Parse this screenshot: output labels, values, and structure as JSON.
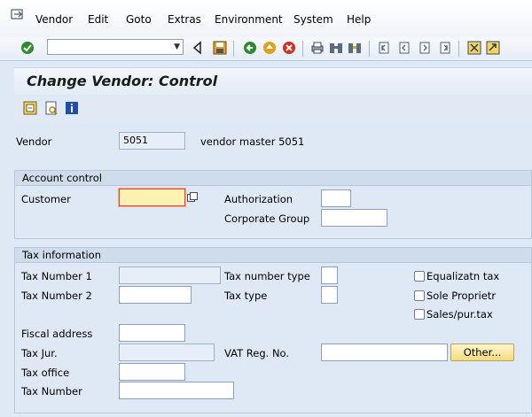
{
  "menu": {
    "items": [
      "Vendor",
      "Edit",
      "Goto",
      "Extras",
      "Environment",
      "System",
      "Help"
    ]
  },
  "toolbar": {
    "command_field_value": "",
    "icons": [
      "enter-icon",
      "back-arrow-icon",
      "save-icon",
      "back-icon",
      "exit-icon",
      "cancel-icon",
      "print-icon",
      "find-icon",
      "find-next-icon",
      "first-page-icon",
      "previous-page-icon",
      "next-page-icon",
      "last-page-icon",
      "create-session-icon",
      "shortcut-icon"
    ]
  },
  "title": "Change Vendor: Control",
  "app_toolbar": {
    "icons": [
      "other-vendor-icon",
      "display-icon",
      "info-icon"
    ]
  },
  "header": {
    "vendor_label": "Vendor",
    "vendor_value": "5051",
    "vendor_name": "vendor master 5051"
  },
  "account_control": {
    "title": "Account control",
    "customer_label": "Customer",
    "customer_value": "",
    "authorization_label": "Authorization",
    "authorization_value": "",
    "corporate_group_label": "Corporate Group",
    "corporate_group_value": ""
  },
  "tax_information": {
    "title": "Tax information",
    "tax_number_1_label": "Tax Number 1",
    "tax_number_1_value": "",
    "tax_number_2_label": "Tax Number 2",
    "tax_number_2_value": "",
    "tax_number_type_label": "Tax number type",
    "tax_number_type_value": "",
    "tax_type_label": "Tax type",
    "tax_type_value": "",
    "equalization_tax_label": "Equalizatn tax",
    "sole_proprietor_label": "Sole Proprietr",
    "sales_pur_tax_label": "Sales/pur.tax",
    "fiscal_address_label": "Fiscal address",
    "fiscal_address_value": "",
    "tax_jur_label": "Tax Jur.",
    "tax_jur_value": "",
    "vat_reg_label": "VAT Reg. No.",
    "vat_reg_value": "",
    "other_button": "Other...",
    "tax_office_label": "Tax office",
    "tax_office_value": "",
    "tax_number_label": "Tax Number",
    "tax_number_value": ""
  },
  "colors": {
    "background": "#dfe9f5",
    "required_field": "#fdf3b0",
    "required_border": "#e04a3c",
    "button": "#f3dc7e"
  }
}
